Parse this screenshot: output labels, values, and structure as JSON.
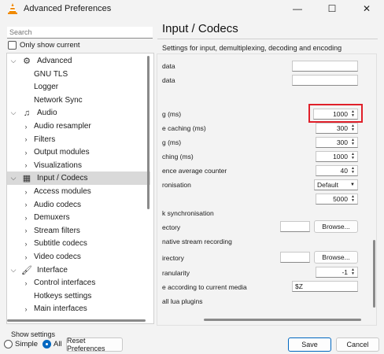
{
  "window": {
    "title": "Advanced Preferences",
    "controls": [
      "—",
      "☐",
      "✕"
    ],
    "accent": "#0067c0",
    "highlight_color": "#e0202a"
  },
  "search": {
    "placeholder": "Search"
  },
  "only_show_current": "Only show current",
  "tree": [
    {
      "label": "Advanced",
      "level": 0,
      "chevron": "⌵",
      "icon": "gear-icon",
      "glyph": "⚙"
    },
    {
      "label": "GNU TLS",
      "level": 1
    },
    {
      "label": "Logger",
      "level": 1
    },
    {
      "label": "Network Sync",
      "level": 1
    },
    {
      "label": "Audio",
      "level": 0,
      "chevron": "⌵",
      "icon": "music-note-icon",
      "glyph": "♫"
    },
    {
      "label": "Audio resampler",
      "level": 1,
      "chevron": "›"
    },
    {
      "label": "Filters",
      "level": 1,
      "chevron": "›"
    },
    {
      "label": "Output modules",
      "level": 1,
      "chevron": "›"
    },
    {
      "label": "Visualizations",
      "level": 1,
      "chevron": "›"
    },
    {
      "label": "Input / Codecs",
      "level": 0,
      "chevron": "⌵",
      "icon": "input-codecs-icon",
      "glyph": "▦",
      "selected": true
    },
    {
      "label": "Access modules",
      "level": 1,
      "chevron": "›"
    },
    {
      "label": "Audio codecs",
      "level": 1,
      "chevron": "›"
    },
    {
      "label": "Demuxers",
      "level": 1,
      "chevron": "›"
    },
    {
      "label": "Stream filters",
      "level": 1,
      "chevron": "›"
    },
    {
      "label": "Subtitle codecs",
      "level": 1,
      "chevron": "›"
    },
    {
      "label": "Video codecs",
      "level": 1,
      "chevron": "›"
    },
    {
      "label": "Interface",
      "level": 0,
      "chevron": "⌵",
      "icon": "paint-roller-icon",
      "glyph": "🖌"
    },
    {
      "label": "Control interfaces",
      "level": 1,
      "chevron": "›"
    },
    {
      "label": "Hotkeys settings",
      "level": 1
    },
    {
      "label": "Main interfaces",
      "level": 1,
      "chevron": "›"
    }
  ],
  "panel": {
    "title": "Input / Codecs",
    "subtitle": "Settings for input, demultiplexing, decoding and encoding",
    "rows": {
      "r1": "data",
      "r2": "data",
      "r3": "g (ms)",
      "r3_value": "1000",
      "r4": "e caching (ms)",
      "r4_value": "300",
      "r5": "g (ms)",
      "r5_value": "300",
      "r6": "ching (ms)",
      "r6_value": "1000",
      "r7": "ence average counter",
      "r7_value": "40",
      "r8": "ronisation",
      "r8_value": "Default",
      "r9_value": "5000",
      "r10": "k synchronisation",
      "r11": "ectory",
      "r11_button": "Browse...",
      "r12": "native stream recording",
      "r13": "irectory",
      "r13_button": "Browse...",
      "r14": "ranularity",
      "r14_value": "-1",
      "r15": "e according to current media",
      "r15_value": "$Z",
      "r16": "all lua plugins"
    }
  },
  "footer": {
    "show_settings": "Show settings",
    "simple": "Simple",
    "all": "All",
    "all_selected": true,
    "reset": "Reset Preferences",
    "save": "Save",
    "cancel": "Cancel"
  }
}
